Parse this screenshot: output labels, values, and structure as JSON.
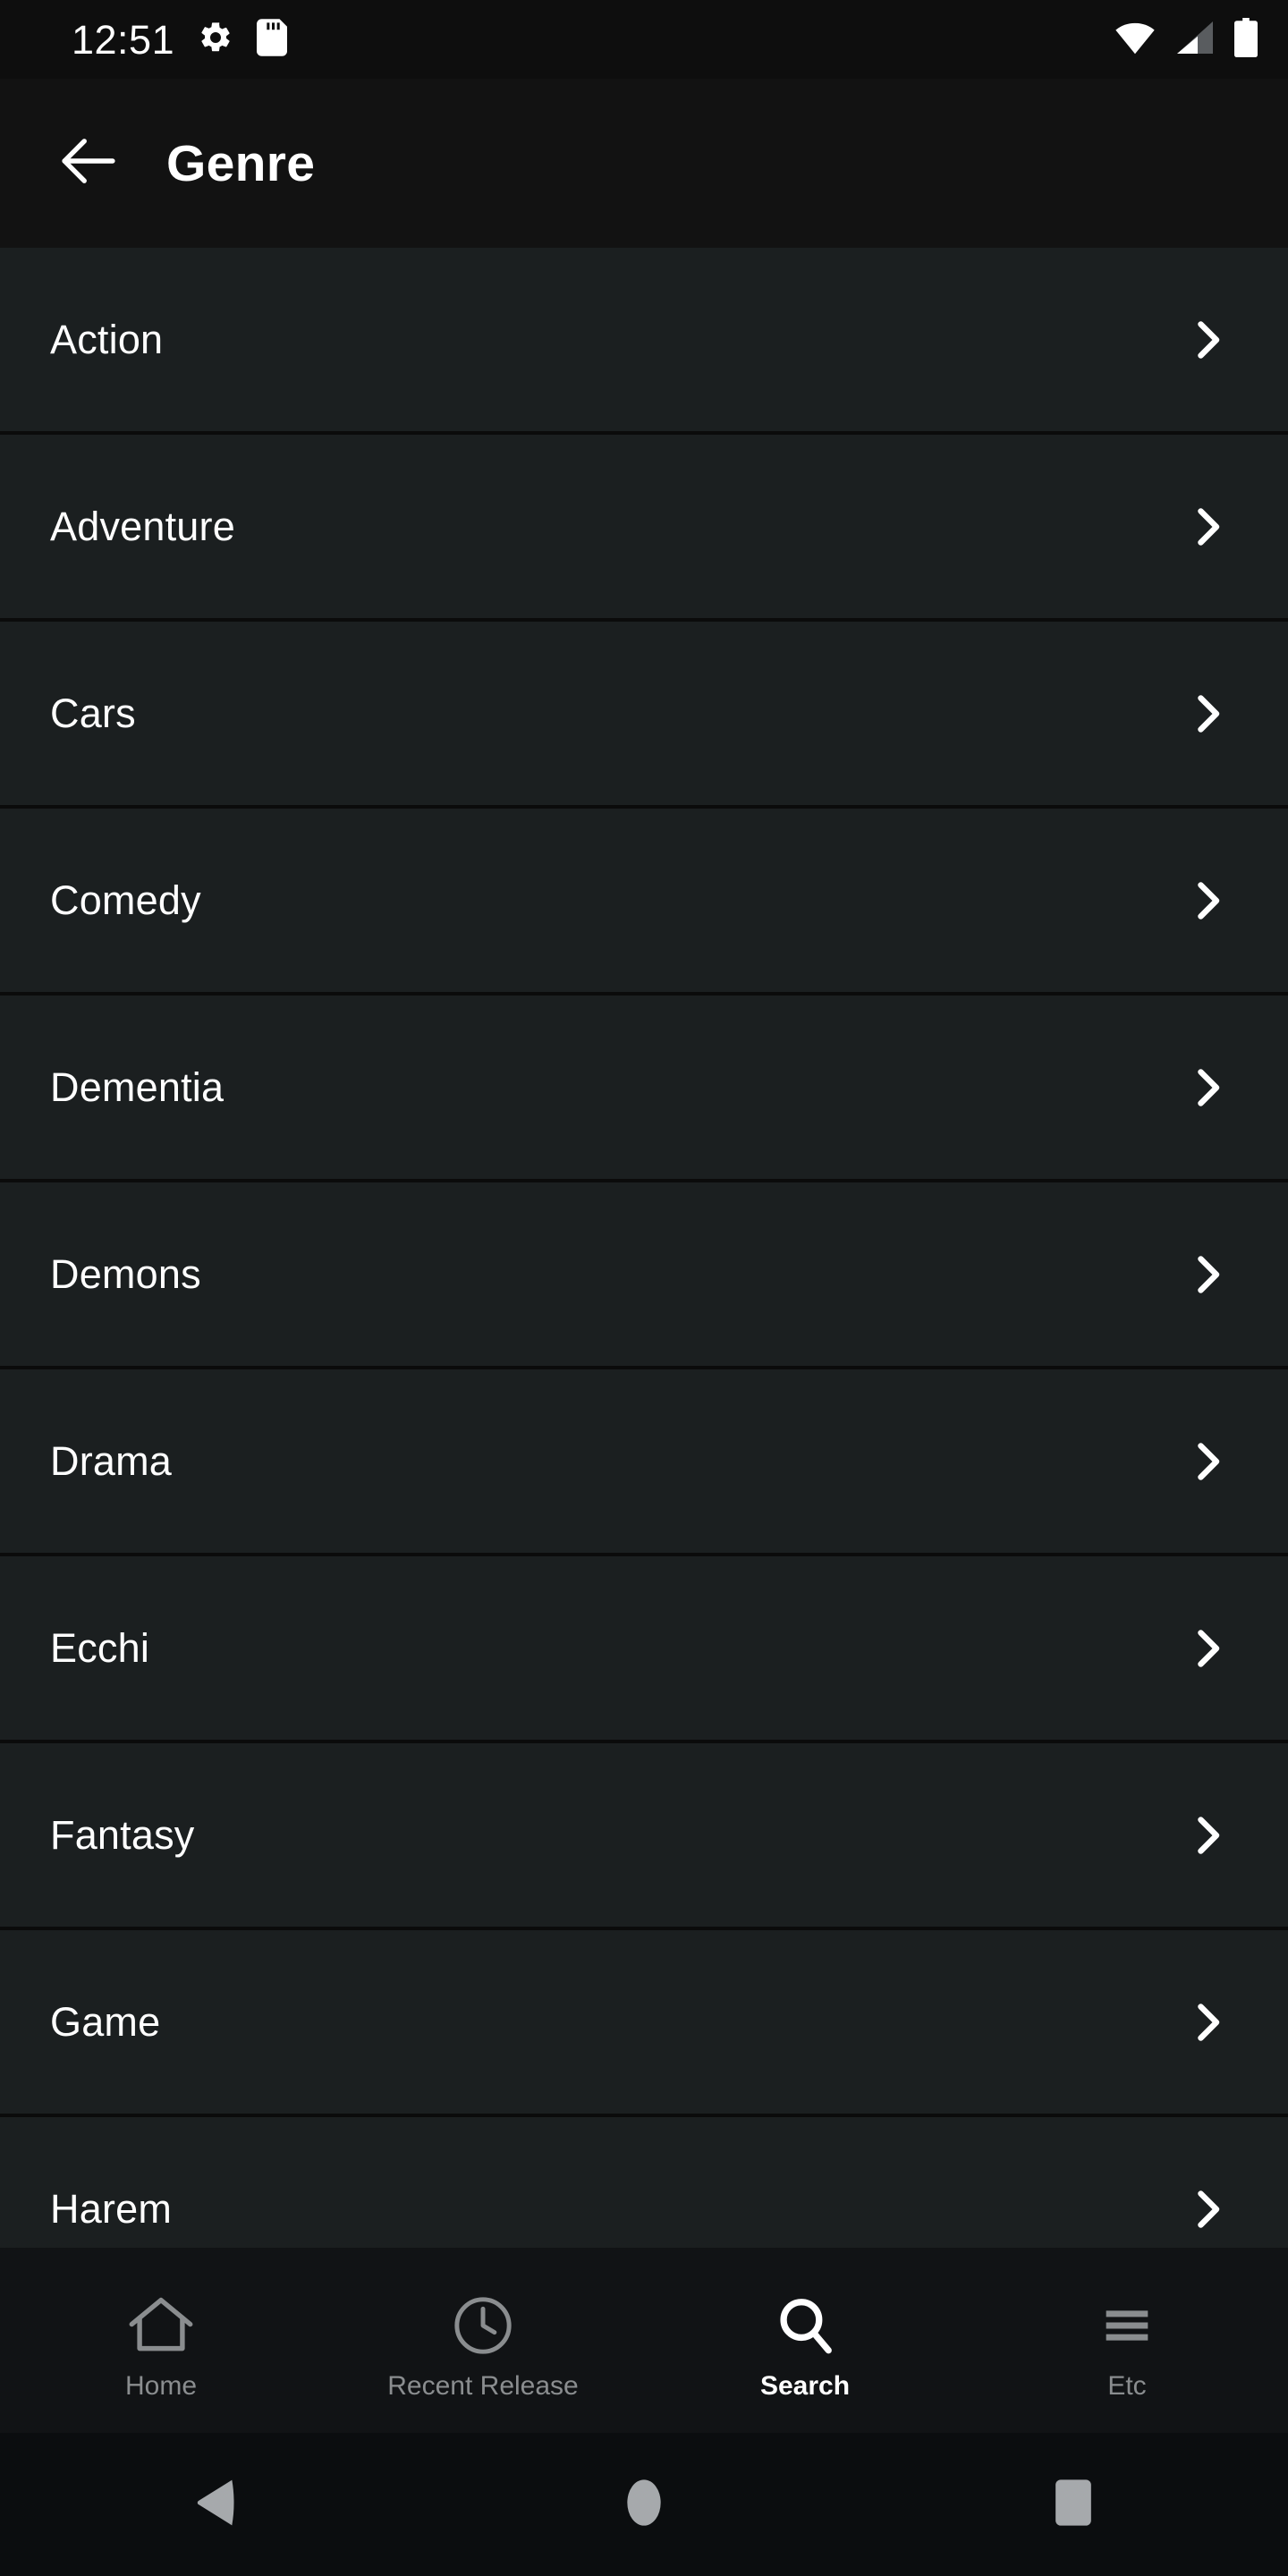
{
  "status_bar": {
    "time": "12:51",
    "left_icons": [
      "gear-icon",
      "sd-card-icon"
    ],
    "right_icons": [
      "wifi-icon",
      "cellular-signal-icon",
      "battery-icon"
    ],
    "colors": {
      "background": "#0e0e0e",
      "foreground": "#ffffff"
    }
  },
  "app_bar": {
    "back_icon": "arrow-left-icon",
    "title": "Genre",
    "background": "#121212"
  },
  "genre_list": {
    "row_accessory_icon": "chevron-right-icon",
    "background": "#1b1f20",
    "divider_color": "#0b0b0b",
    "items": [
      {
        "label": "Action"
      },
      {
        "label": "Adventure"
      },
      {
        "label": "Cars"
      },
      {
        "label": "Comedy"
      },
      {
        "label": "Dementia"
      },
      {
        "label": "Demons"
      },
      {
        "label": "Drama"
      },
      {
        "label": "Ecchi"
      },
      {
        "label": "Fantasy"
      },
      {
        "label": "Game"
      },
      {
        "label": "Harem"
      }
    ]
  },
  "bottom_nav": {
    "background": "#111315",
    "active_color": "#ffffff",
    "inactive_color": "#8a8d8f",
    "items": [
      {
        "label": "Home",
        "icon": "home-icon",
        "active": false
      },
      {
        "label": "Recent Release",
        "icon": "clock-icon",
        "active": false
      },
      {
        "label": "Search",
        "icon": "search-icon",
        "active": true
      },
      {
        "label": "Etc",
        "icon": "hamburger-menu-icon",
        "active": false
      }
    ]
  },
  "system_nav": {
    "background": "#0b0d0f",
    "items": [
      {
        "icon": "back-triangle-icon"
      },
      {
        "icon": "home-circle-icon"
      },
      {
        "icon": "recents-square-icon"
      }
    ]
  }
}
